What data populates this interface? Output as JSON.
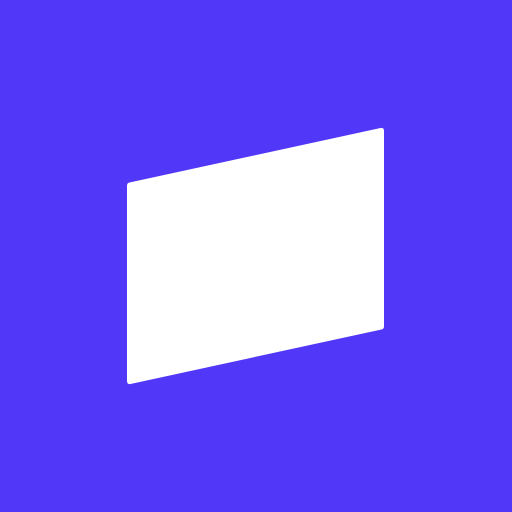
{
  "app_icon": {
    "background_color": "#5137F7",
    "logo_shape": "slanted-parallelogram",
    "logo_color": "#FFFFFF"
  }
}
